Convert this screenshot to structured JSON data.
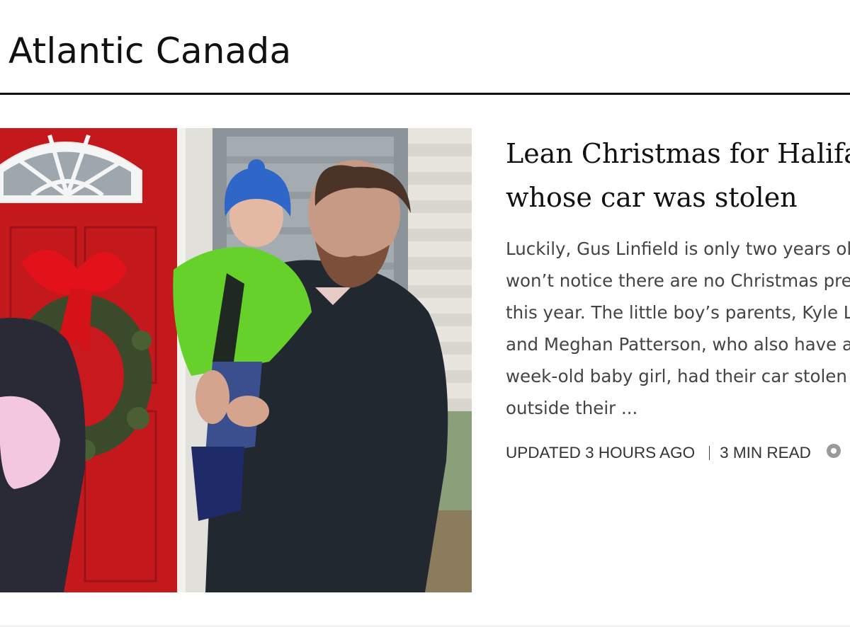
{
  "section": {
    "title": "Atlantic Canada"
  },
  "story": {
    "headline_lines": [
      "Lean Christmas for Halifax family",
      "whose car was stolen"
    ],
    "summary_lines": [
      "Luckily, Gus Linfield is only two years old and",
      "won’t notice there are no Christmas presents",
      "this year. The little boy’s parents, Kyle Linfield",
      "and Meghan Patterson, who also have a two-",
      "week-old baby girl, had their car stolen from",
      "outside their ..."
    ],
    "updated": "UPDATED 3 HOURS AGO",
    "read_time": "3 MIN READ",
    "comment_icon": "comment-icon",
    "image_icon": "photo"
  },
  "colors": {
    "text": "#111111",
    "summary": "#444444",
    "door_red": "#c81a1e",
    "jacket_green": "#66d12a",
    "hat_blue": "#2f67c8",
    "coat_dark": "#222830"
  }
}
